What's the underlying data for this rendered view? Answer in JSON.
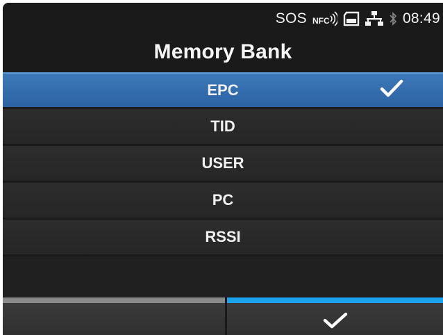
{
  "status_bar": {
    "sos_label": "SOS",
    "nfc_label": "NFC",
    "time": "08:49",
    "icons": [
      "nfc-icon",
      "sd-card-icon",
      "network-icon",
      "bluetooth-icon"
    ]
  },
  "screen": {
    "title": "Memory Bank"
  },
  "menu": {
    "items": [
      {
        "label": "EPC",
        "selected": true
      },
      {
        "label": "TID",
        "selected": false
      },
      {
        "label": "USER",
        "selected": false
      },
      {
        "label": "PC",
        "selected": false
      },
      {
        "label": "RSSI",
        "selected": false
      }
    ]
  },
  "footer": {
    "left_button": "blank",
    "right_button": "check-icon"
  },
  "colors": {
    "background": "#1a1a1a",
    "selected_row": "#2b62a3",
    "accent_bar": "#1aa3ea",
    "inactive_bar": "#8a8a8a",
    "text": "#f0f0f0"
  }
}
